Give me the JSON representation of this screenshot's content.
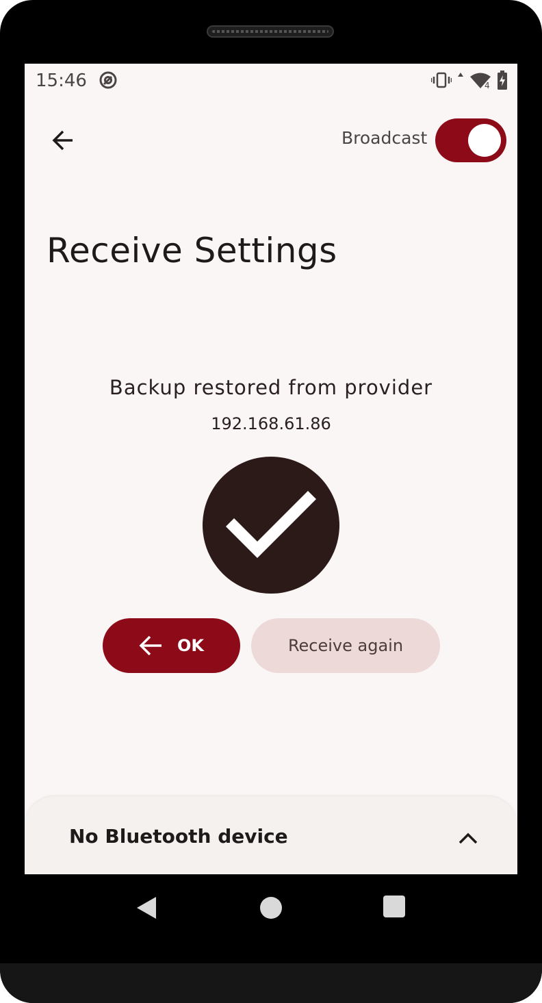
{
  "status_bar": {
    "time": "15:46",
    "icons": [
      "at-sign-icon",
      "vibrate-icon",
      "signal-icon",
      "wifi-icon",
      "battery-charging-icon"
    ],
    "network_badge": "4"
  },
  "app_bar": {
    "back_icon": "arrow-left-icon",
    "broadcast_label": "Broadcast",
    "broadcast_enabled": true
  },
  "page": {
    "title": "Receive Settings",
    "message": "Backup restored from provider",
    "address": "192.168.61.86",
    "status_icon": "checkmark-icon"
  },
  "actions": {
    "ok_label": "OK",
    "receive_again_label": "Receive again"
  },
  "bluetooth_sheet": {
    "label": "No Bluetooth device",
    "chevron": "chevron-up-icon"
  },
  "colors": {
    "accent": "#8d0a18",
    "background": "#faf6f5",
    "secondary_button": "#edd9d8",
    "check_circle": "#2c1a18"
  }
}
